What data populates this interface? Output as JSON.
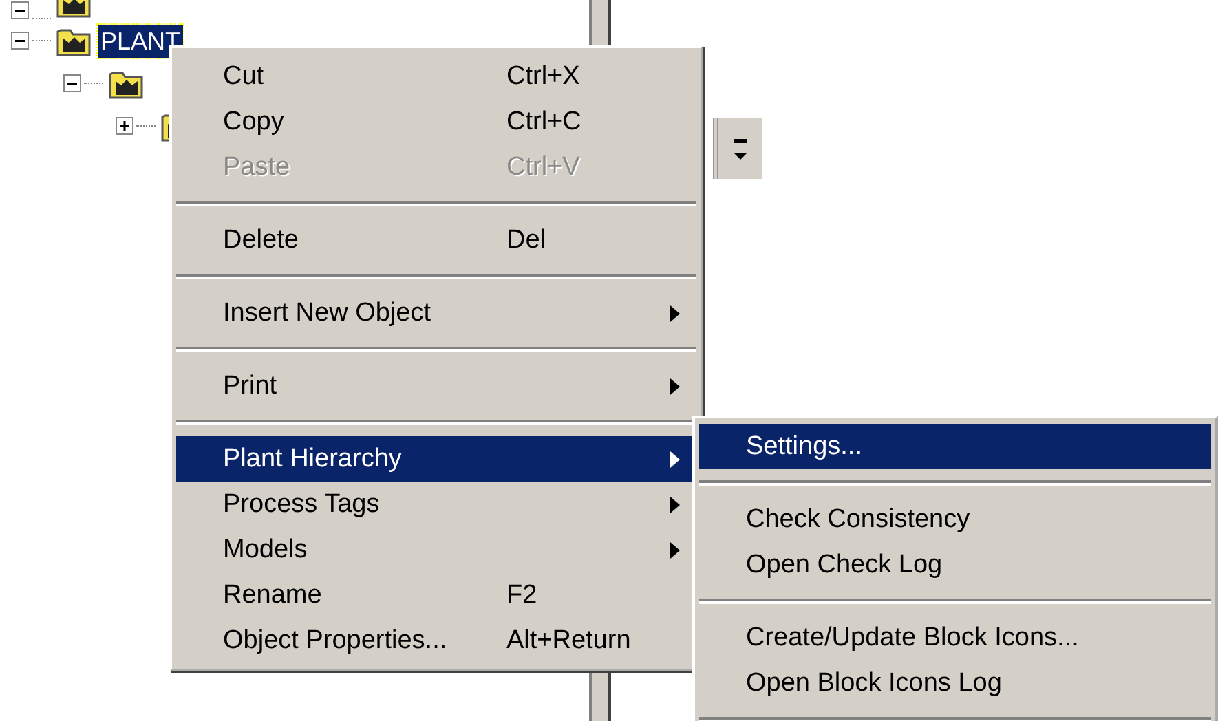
{
  "tree": {
    "items": [
      {
        "expanded": true
      },
      {
        "label": "PLANT",
        "expanded": true,
        "selected": true,
        "children": [
          {
            "expanded": true,
            "children": [
              {
                "expanded": false
              }
            ]
          }
        ]
      }
    ]
  },
  "context_menu": {
    "items": [
      {
        "kind": "item",
        "label": "Cut",
        "shortcut": "Ctrl+X",
        "submenu": false,
        "disabled": false,
        "selected": false
      },
      {
        "kind": "item",
        "label": "Copy",
        "shortcut": "Ctrl+C",
        "submenu": false,
        "disabled": false,
        "selected": false
      },
      {
        "kind": "item",
        "label": "Paste",
        "shortcut": "Ctrl+V",
        "submenu": false,
        "disabled": true,
        "selected": false
      },
      {
        "kind": "separator"
      },
      {
        "kind": "item",
        "label": "Delete",
        "shortcut": "Del",
        "submenu": false,
        "disabled": false,
        "selected": false
      },
      {
        "kind": "separator"
      },
      {
        "kind": "item",
        "label": "Insert New Object",
        "submenu": true,
        "disabled": false,
        "selected": false
      },
      {
        "kind": "separator"
      },
      {
        "kind": "item",
        "label": "Print",
        "submenu": true,
        "disabled": false,
        "selected": false
      },
      {
        "kind": "separator"
      },
      {
        "kind": "item",
        "label": "Plant Hierarchy",
        "submenu": true,
        "disabled": false,
        "selected": true
      },
      {
        "kind": "item",
        "label": "Process Tags",
        "submenu": true,
        "disabled": false,
        "selected": false
      },
      {
        "kind": "item",
        "label": "Models",
        "submenu": true,
        "disabled": false,
        "selected": false
      },
      {
        "kind": "item",
        "label": "Rename",
        "shortcut": "F2",
        "submenu": false,
        "disabled": false,
        "selected": false
      },
      {
        "kind": "item",
        "label": "Object Properties...",
        "shortcut": "Alt+Return",
        "submenu": false,
        "disabled": false,
        "selected": false
      }
    ]
  },
  "submenu": {
    "items": [
      {
        "kind": "item",
        "label": "Settings...",
        "selected": true
      },
      {
        "kind": "separator"
      },
      {
        "kind": "item",
        "label": "Check Consistency",
        "selected": false
      },
      {
        "kind": "item",
        "label": "Open Check Log",
        "selected": false
      },
      {
        "kind": "separator"
      },
      {
        "kind": "item",
        "label": "Create/Update Block Icons...",
        "selected": false
      },
      {
        "kind": "item",
        "label": "Open Block Icons Log",
        "selected": false
      },
      {
        "kind": "separator"
      }
    ]
  }
}
